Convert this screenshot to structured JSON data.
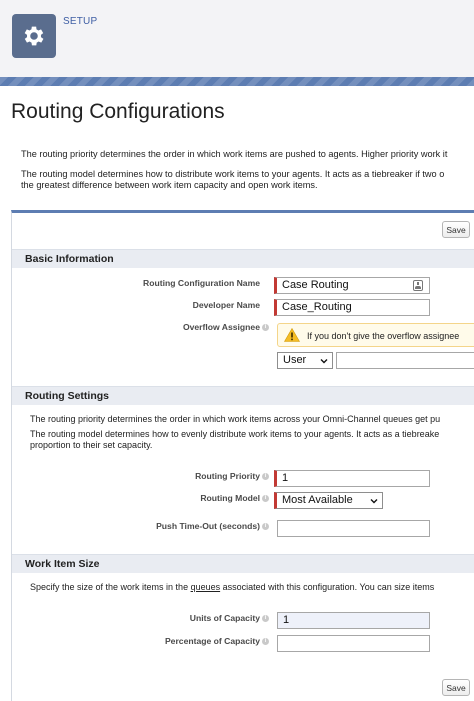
{
  "header": {
    "setup_label": "SETUP",
    "icon": "gear-icon",
    "accent": "#5d7db2"
  },
  "page": {
    "title": "Routing Configurations",
    "intro_1": "The routing priority determines the order in which work items are pushed to agents. Higher priority work it",
    "intro_2a": "The routing model determines how to distribute work items to your agents. It acts as a tiebreaker if two o",
    "intro_2b": "the greatest difference between work item capacity and open work items."
  },
  "toolbar": {
    "save_label": "Save"
  },
  "basic": {
    "heading": "Basic Information",
    "name_label": "Routing Configuration Name",
    "name_value": "Case Routing",
    "dev_label": "Developer Name",
    "dev_value": "Case_Routing",
    "overflow_label": "Overflow Assignee",
    "overflow_warning": "If you don't give the overflow assignee",
    "assignee_type": "User",
    "assignee_value": ""
  },
  "routing": {
    "heading": "Routing Settings",
    "text_1": "The routing priority determines the order in which work items across your Omni-Channel queues get pu",
    "text_2a": "The routing model determines how to evenly distribute work items to your agents. It acts as a tiebreake",
    "text_2b": "proportion to their set capacity.",
    "priority_label": "Routing Priority",
    "priority_value": "1",
    "model_label": "Routing Model",
    "model_value": "Most Available",
    "timeout_label": "Push Time-Out (seconds)",
    "timeout_value": ""
  },
  "work_item": {
    "heading": "Work Item Size",
    "text_pre": "Specify the size of the work items in the ",
    "text_link": "queues",
    "text_post": " associated with this configuration. You can size items",
    "units_label": "Units of Capacity",
    "units_value": "1",
    "percent_label": "Percentage of Capacity",
    "percent_value": ""
  },
  "info_glyph": "i"
}
